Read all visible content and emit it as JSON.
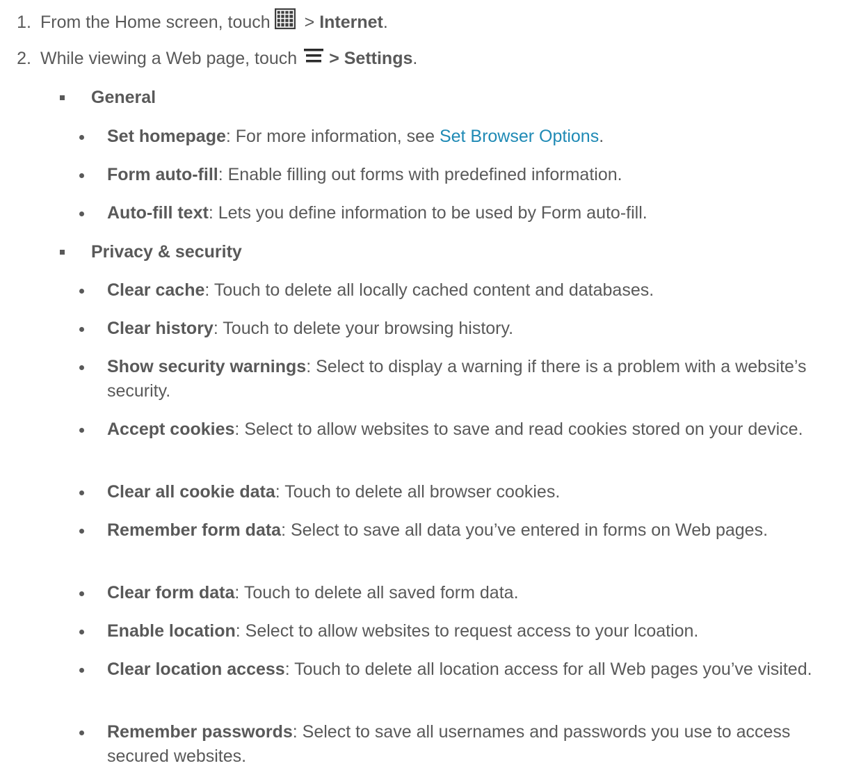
{
  "steps": [
    {
      "number": "1.",
      "before": "From the Home screen, touch",
      "icon": "apps-grid-icon",
      "after": " > ",
      "bold": "Internet",
      "end": "."
    },
    {
      "number": "2.",
      "before": "While viewing a Web page, touch",
      "icon": "menu-icon",
      "bold_after": "> Settings",
      "end": "."
    }
  ],
  "sections": [
    {
      "title": "General",
      "items": [
        {
          "term": "Set homepage",
          "desc": ": For more information, see ",
          "link": "Set Browser Options",
          "end": "."
        },
        {
          "term": "Form auto-fill",
          "desc": ": Enable filling out forms with predefined information."
        },
        {
          "term": "Auto-fill text",
          "desc": ": Lets you define information to be used by Form auto-fill."
        }
      ]
    },
    {
      "title": "Privacy & security",
      "items": [
        {
          "term": "Clear cache",
          "desc": ": Touch to delete all locally cached content and databases."
        },
        {
          "term": "Clear history",
          "desc": ": Touch to delete your browsing history."
        },
        {
          "term": "Show security warnings",
          "desc": ": Select to display a warning if there is a problem with a website’s security."
        },
        {
          "term": "Accept cookies",
          "desc": ": Select to allow websites to save and read cookies stored on your device."
        },
        {
          "term": "Clear all cookie data",
          "desc": ": Touch to delete all browser cookies."
        },
        {
          "term": "Remember form data",
          "desc": ": Select to save all data you’ve entered in forms on Web pages."
        },
        {
          "term": "Clear form data",
          "desc": ": Touch to delete all saved form data."
        },
        {
          "term": "Enable location",
          "desc": ": Select to allow websites to request access to your lcoation."
        },
        {
          "term": "Clear location access",
          "desc": ": Touch to delete all location access for all Web pages you’ve visited."
        },
        {
          "term": "Remember passwords",
          "desc": ": Select to save all usernames and passwords you use to access secured websites."
        }
      ]
    }
  ],
  "colors": {
    "text": "#595959",
    "link": "#1f8ab5"
  }
}
